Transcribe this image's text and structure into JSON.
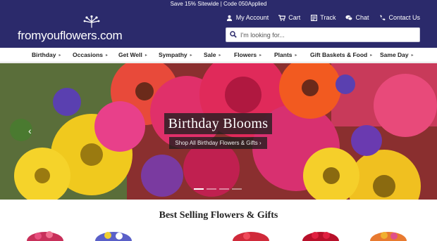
{
  "promo": {
    "text": "Save 15% Sitewide | Code 050Applied"
  },
  "logo": {
    "text": "fromyouflowers.com"
  },
  "utility_nav": [
    {
      "label": "My Account",
      "icon": "user-icon"
    },
    {
      "label": "Cart",
      "icon": "cart-icon"
    },
    {
      "label": "Track",
      "icon": "track-icon"
    },
    {
      "label": "Chat",
      "icon": "chat-icon"
    },
    {
      "label": "Contact Us",
      "icon": "phone-icon"
    }
  ],
  "search": {
    "placeholder": "I'm looking for..."
  },
  "main_nav": [
    {
      "label": "Birthday"
    },
    {
      "label": "Occasions"
    },
    {
      "label": "Get Well"
    },
    {
      "label": "Sympathy"
    },
    {
      "label": "Sale"
    },
    {
      "label": "Flowers"
    },
    {
      "label": "Plants"
    },
    {
      "label": "Gift Baskets & Food"
    },
    {
      "label": "Same Day"
    }
  ],
  "hero": {
    "title": "Birthday Blooms",
    "cta": "Shop All Birthday Flowers & Gifts ›",
    "prev_icon": "chevron-left-icon"
  },
  "section": {
    "title": "Best Selling Flowers & Gifts"
  },
  "colors": {
    "brand": "#2b2a6b",
    "nav_text": "#222222"
  }
}
